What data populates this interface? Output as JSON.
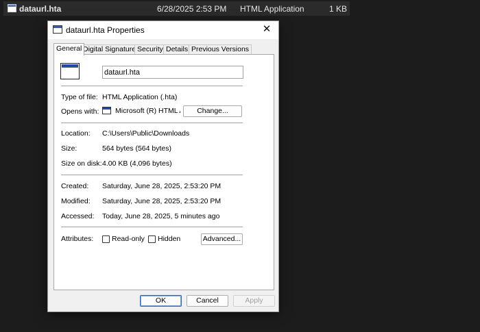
{
  "file_row": {
    "name": "dataurl.hta",
    "date": "6/28/2025 2:53 PM",
    "type": "HTML Application",
    "size": "1 KB"
  },
  "dialog": {
    "title": "dataurl.hta Properties",
    "close": "✕",
    "tabs": [
      "General",
      "Digital Signatures",
      "Security",
      "Details",
      "Previous Versions"
    ],
    "active_tab": "General",
    "file_name_value": "dataurl.hta",
    "type_of_file_label": "Type of file:",
    "type_of_file_value": "HTML Application (.hta)",
    "opens_with_label": "Opens with:",
    "opens_with_value": "Microsoft (R) HTML Application host",
    "change_button": "Change...",
    "location_label": "Location:",
    "location_value": "C:\\Users\\Public\\Downloads",
    "size_label": "Size:",
    "size_value": "564 bytes (564 bytes)",
    "size_on_disk_label": "Size on disk:",
    "size_on_disk_value": "4.00 KB (4,096 bytes)",
    "created_label": "Created:",
    "created_value": "Saturday, June 28, 2025, 2:53:20 PM",
    "modified_label": "Modified:",
    "modified_value": "Saturday, June 28, 2025, 2:53:20 PM",
    "accessed_label": "Accessed:",
    "accessed_value": "Today, June 28, 2025, 5 minutes ago",
    "attributes_label": "Attributes:",
    "read_only_label": "Read-only",
    "read_only_checked": false,
    "hidden_label": "Hidden",
    "hidden_checked": false,
    "advanced_button": "Advanced...",
    "ok_button": "OK",
    "cancel_button": "Cancel",
    "apply_button": "Apply"
  }
}
